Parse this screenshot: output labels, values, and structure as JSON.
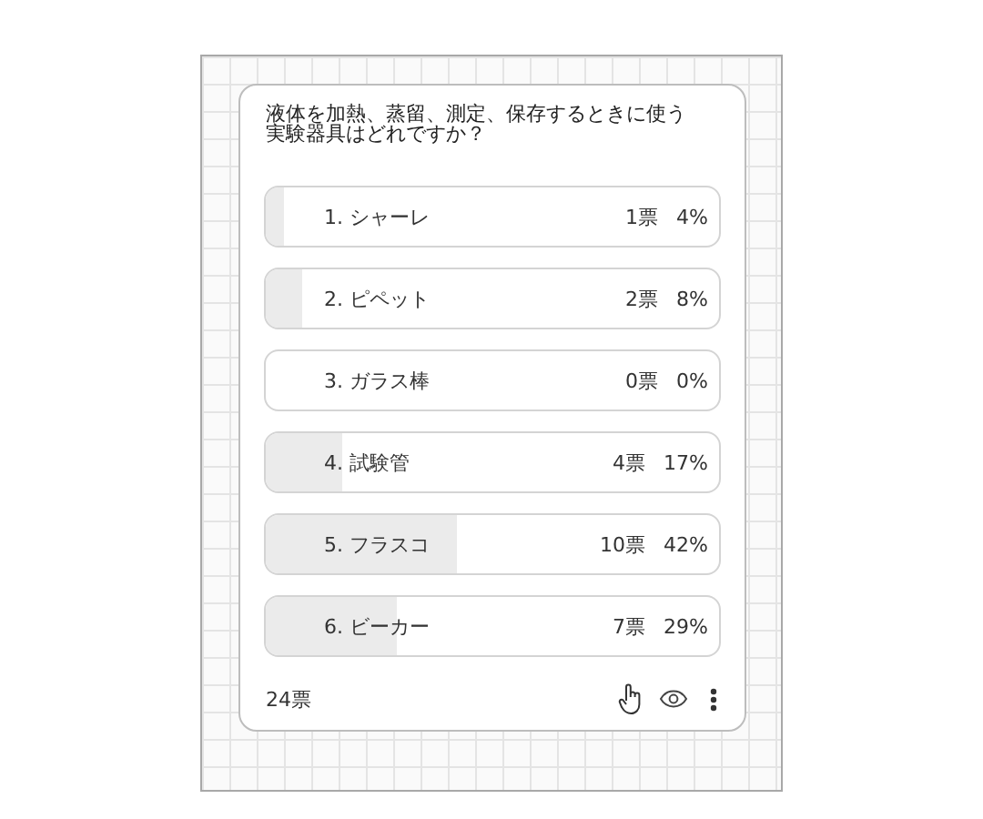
{
  "question": "液体を加熱、蒸留、測定、保存するときに使う実験器具はどれですか？",
  "options": [
    {
      "label": "1. シャーレ",
      "votes": "1票",
      "percent": "4%",
      "level": 0.04
    },
    {
      "label": "2. ピペット",
      "votes": "2票",
      "percent": "8%",
      "level": 0.08
    },
    {
      "label": "3. ガラス棒",
      "votes": "0票",
      "percent": "0%"
    },
    {
      "label": "4. 試験管",
      "votes": "4票",
      "percent": "17%",
      "level": 0.17
    },
    {
      "label": "5. フラスコ",
      "votes": "10票",
      "percent": "42%",
      "level": 0.42
    },
    {
      "label": "6. ビーカー",
      "votes": "7票",
      "percent": "29%",
      "level": 0.29
    }
  ],
  "total": "24票"
}
